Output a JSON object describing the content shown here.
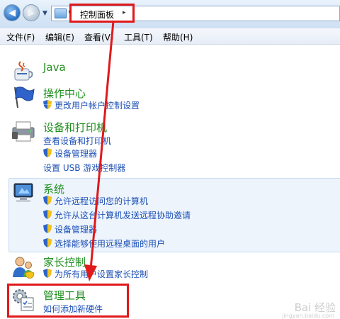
{
  "address_bar": {
    "breadcrumb": "控制面板",
    "separator": "▸"
  },
  "menu": {
    "file": "文件(F)",
    "edit": "编辑(E)",
    "view": "查看(V)",
    "tools": "工具(T)",
    "help": "帮助(H)"
  },
  "items": {
    "java": {
      "title": "Java"
    },
    "action_center": {
      "title": "操作中心",
      "links": [
        "更改用户帐户控制设置"
      ]
    },
    "devices": {
      "title": "设备和打印机",
      "links": [
        "查看设备和打印机",
        "设备管理器",
        "设置 USB 游戏控制器"
      ]
    },
    "system": {
      "title": "系统",
      "links": [
        "允许远程访问您的计算机",
        "允许从这台计算机发送远程协助邀请",
        "设备管理器",
        "选择能够使用远程桌面的用户"
      ]
    },
    "parental": {
      "title": "家长控制",
      "links": [
        "为所有用户设置家长控制"
      ]
    },
    "admin_tools": {
      "title": "管理工具",
      "links": [
        "如何添加新硬件"
      ]
    }
  },
  "watermark": {
    "text": "Bai 经验",
    "sub": "jingyan.baidu.com"
  },
  "colors": {
    "annotation_red": "#e0191b",
    "title_green": "#1e8e1e",
    "link_blue": "#1c4fb5"
  }
}
